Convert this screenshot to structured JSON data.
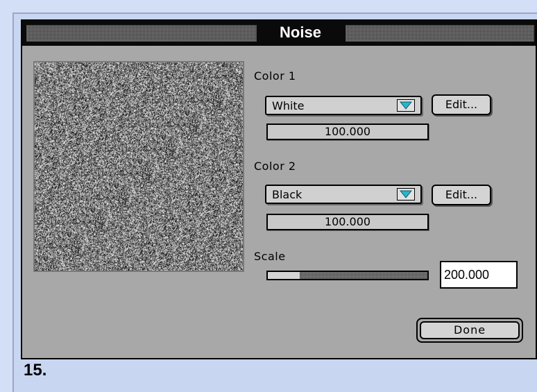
{
  "dialog": {
    "title": "Noise",
    "color1": {
      "label": "Color 1",
      "selected": "White",
      "edit_label": "Edit...",
      "value": "100.000"
    },
    "color2": {
      "label": "Color 2",
      "selected": "Black",
      "edit_label": "Edit...",
      "value": "100.000"
    },
    "scale": {
      "label": "Scale",
      "value": "200.000",
      "slider_fraction": 0.2
    },
    "done_label": "Done"
  },
  "caption": "15.",
  "colors": {
    "background": "#d3def7",
    "dialog": "#a8a8a8",
    "arrow": "#2bb4c8"
  },
  "icons": [
    "dropdown-arrow-icon"
  ]
}
